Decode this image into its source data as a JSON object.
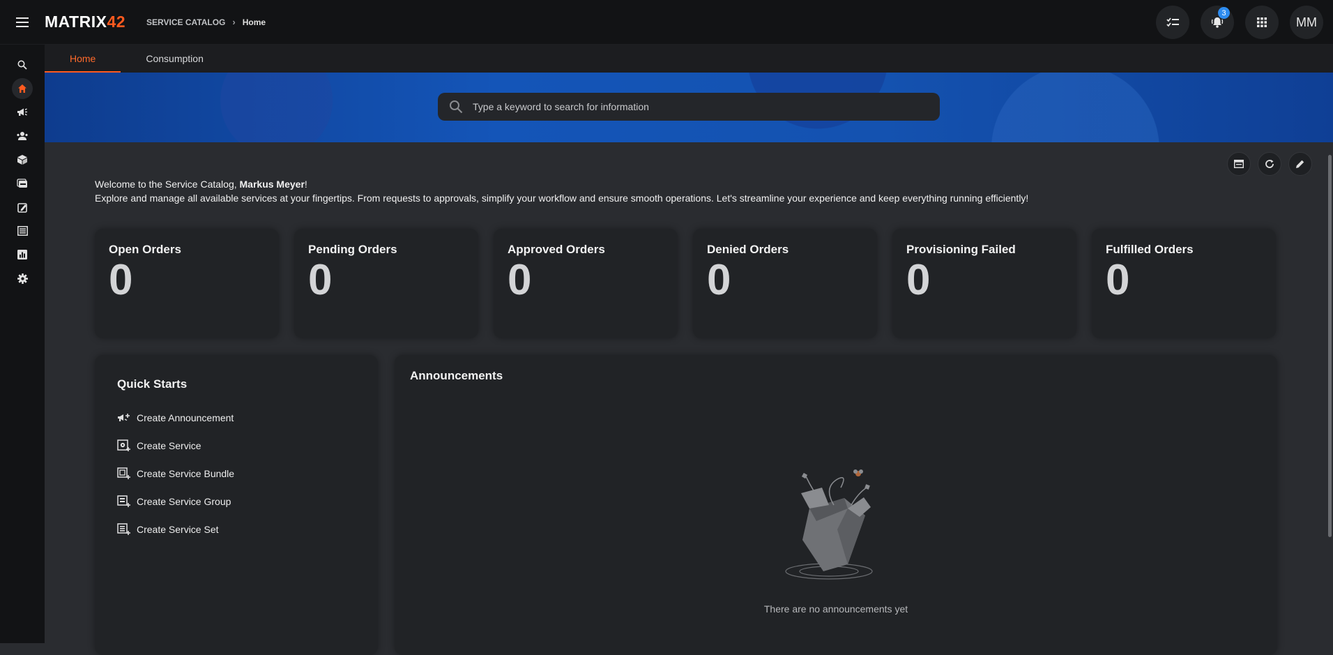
{
  "header": {
    "logo_text": "MATRIX",
    "logo_num": "42",
    "breadcrumb": [
      "SERVICE CATALOG",
      "Home"
    ],
    "notification_count": "3",
    "avatar_initials": "MM"
  },
  "tabs": [
    {
      "label": "Home",
      "active": true
    },
    {
      "label": "Consumption",
      "active": false
    }
  ],
  "search": {
    "placeholder": "Type a keyword to search for information"
  },
  "welcome": {
    "line1_prefix": "Welcome to the Service Catalog, ",
    "user_name": "Markus Meyer",
    "line1_suffix": "!",
    "line2": "Explore and manage all available services at your fingertips. From requests to approvals, simplify your workflow and ensure smooth operations. Let's streamline your experience and keep everything running efficiently!"
  },
  "cards": [
    {
      "label": "Open Orders",
      "value": "0"
    },
    {
      "label": "Pending Orders",
      "value": "0"
    },
    {
      "label": "Approved Orders",
      "value": "0"
    },
    {
      "label": "Denied Orders",
      "value": "0"
    },
    {
      "label": "Provisioning Failed",
      "value": "0"
    },
    {
      "label": "Fulfilled Orders",
      "value": "0"
    }
  ],
  "quick_starts": {
    "title": "Quick Starts",
    "items": [
      {
        "label": "Create Announcement",
        "icon": "megaphone-plus-icon"
      },
      {
        "label": "Create Service",
        "icon": "service-plus-icon"
      },
      {
        "label": "Create Service Bundle",
        "icon": "bundle-plus-icon"
      },
      {
        "label": "Create Service Group",
        "icon": "group-plus-icon"
      },
      {
        "label": "Create Service Set",
        "icon": "set-plus-icon"
      }
    ]
  },
  "announcements": {
    "title": "Announcements",
    "empty_text": "There are no announcements yet"
  },
  "colors": {
    "accent": "#ff5a1f",
    "badge": "#2d8cf0",
    "banner": "#1455b8"
  }
}
